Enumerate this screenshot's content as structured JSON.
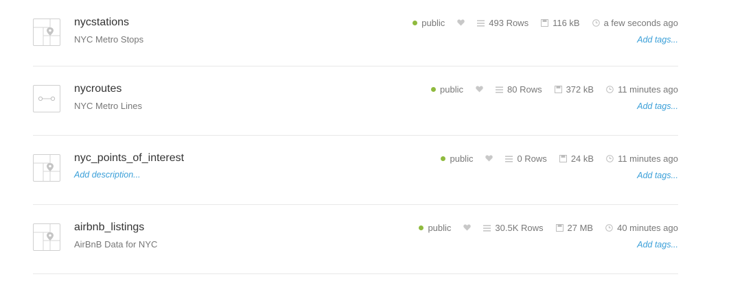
{
  "datasets": [
    {
      "name": "nycstations",
      "description": "NYC Metro Stops",
      "thumbnail_icon": "map-pin-icon",
      "privacy": "public",
      "privacy_color": "#8fba3e",
      "rows": "493 Rows",
      "size": "116 kB",
      "updated": "a few seconds ago",
      "tags_link": "Add tags..."
    },
    {
      "name": "nycroutes",
      "description": "NYC Metro Lines",
      "thumbnail_icon": "line-icon",
      "privacy": "public",
      "privacy_color": "#8fba3e",
      "rows": "80 Rows",
      "size": "372 kB",
      "updated": "11 minutes ago",
      "tags_link": "Add tags..."
    },
    {
      "name": "nyc_points_of_interest",
      "description": "Add description...",
      "thumbnail_icon": "map-pin-icon",
      "privacy": "public",
      "privacy_color": "#8fba3e",
      "rows": "0 Rows",
      "size": "24 kB",
      "updated": "11 minutes ago",
      "tags_link": "Add tags..."
    },
    {
      "name": "airbnb_listings",
      "description": "AirBnB Data for NYC",
      "thumbnail_icon": "map-pin-icon",
      "privacy": "public",
      "privacy_color": "#8fba3e",
      "rows": "30.5K Rows",
      "size": "27 MB",
      "updated": "40 minutes ago",
      "tags_link": "Add tags..."
    }
  ]
}
